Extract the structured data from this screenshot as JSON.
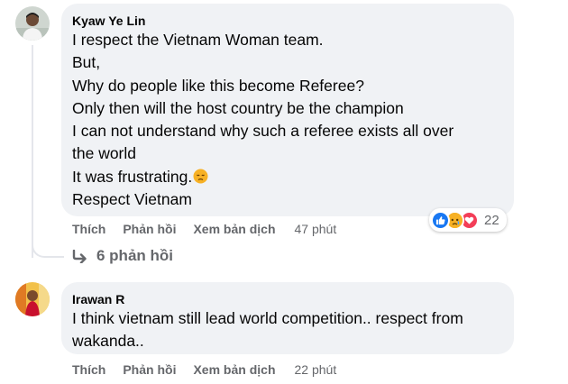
{
  "comments": [
    {
      "author": "Kyaw Ye Lin",
      "lines": [
        "I respect the Vietnam Woman team.",
        "But,",
        "Why do people like this become Referee?",
        "Only then will the host country be the champion",
        "I can not understand why such a referee exists all over",
        "the world",
        "It was frustrating.",
        "Respect Vietnam"
      ],
      "emoji": "sad-face-emoji",
      "actions": {
        "like": "Thích",
        "reply": "Phản hồi",
        "translate": "Xem bản dịch"
      },
      "time": "47 phút",
      "reactions": {
        "icons": [
          "like-icon",
          "sad-icon",
          "love-icon"
        ],
        "count": "22"
      },
      "replies_link": "6 phản hồi"
    },
    {
      "author": "Irawan R",
      "lines": [
        "I think vietnam still lead world competition.. respect from",
        "wakanda.."
      ],
      "actions": {
        "like": "Thích",
        "reply": "Phản hồi",
        "translate": "Xem bản dịch"
      },
      "time": "22 phút"
    }
  ],
  "colors": {
    "bubble": "#f0f2f5",
    "text": "#050505",
    "secondary": "#65676b",
    "like": "#1877f2",
    "love": "#f33e58",
    "sad": "#f7b125"
  }
}
